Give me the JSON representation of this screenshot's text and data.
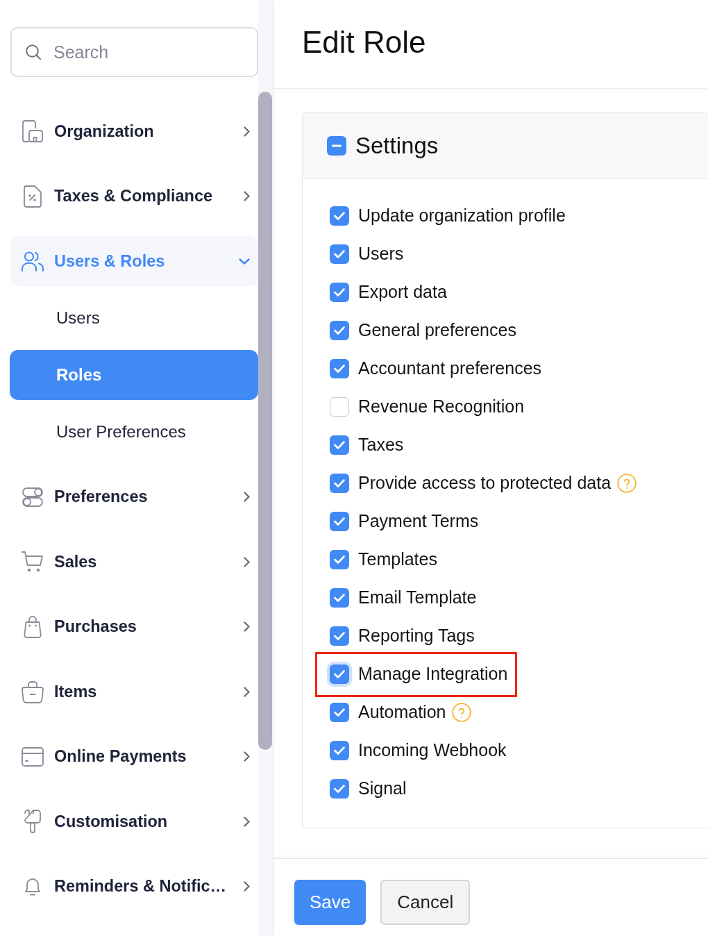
{
  "search": {
    "placeholder": "Search"
  },
  "nav": [
    {
      "label": "Organization",
      "selected": false,
      "expanded": false
    },
    {
      "label": "Taxes & Compliance",
      "selected": false,
      "expanded": false
    },
    {
      "label": "Users & Roles",
      "selected": true,
      "expanded": true,
      "children": [
        {
          "label": "Users",
          "selected": false
        },
        {
          "label": "Roles",
          "selected": true
        },
        {
          "label": "User Preferences",
          "selected": false
        }
      ]
    },
    {
      "label": "Preferences",
      "selected": false,
      "expanded": false
    },
    {
      "label": "Sales",
      "selected": false,
      "expanded": false
    },
    {
      "label": "Purchases",
      "selected": false,
      "expanded": false
    },
    {
      "label": "Items",
      "selected": false,
      "expanded": false
    },
    {
      "label": "Online Payments",
      "selected": false,
      "expanded": false
    },
    {
      "label": "Customisation",
      "selected": false,
      "expanded": false
    },
    {
      "label": "Reminders & Notific…",
      "selected": false,
      "expanded": false
    }
  ],
  "page": {
    "title": "Edit Role"
  },
  "settings": {
    "title": "Settings",
    "select_all_partial": true,
    "items": [
      {
        "label": "Update organization profile",
        "checked": true,
        "help": false,
        "focused": false,
        "highlighted": false
      },
      {
        "label": "Users",
        "checked": true,
        "help": false,
        "focused": false,
        "highlighted": false
      },
      {
        "label": "Export data",
        "checked": true,
        "help": false,
        "focused": false,
        "highlighted": false
      },
      {
        "label": "General preferences",
        "checked": true,
        "help": false,
        "focused": false,
        "highlighted": false
      },
      {
        "label": "Accountant preferences",
        "checked": true,
        "help": false,
        "focused": false,
        "highlighted": false
      },
      {
        "label": "Revenue Recognition",
        "checked": false,
        "help": false,
        "focused": false,
        "highlighted": false
      },
      {
        "label": "Taxes",
        "checked": true,
        "help": false,
        "focused": false,
        "highlighted": false
      },
      {
        "label": "Provide access to protected data",
        "checked": true,
        "help": true,
        "focused": false,
        "highlighted": false
      },
      {
        "label": "Payment Terms",
        "checked": true,
        "help": false,
        "focused": false,
        "highlighted": false
      },
      {
        "label": "Templates",
        "checked": true,
        "help": false,
        "focused": false,
        "highlighted": false
      },
      {
        "label": "Email Template",
        "checked": true,
        "help": false,
        "focused": false,
        "highlighted": false
      },
      {
        "label": "Reporting Tags",
        "checked": true,
        "help": false,
        "focused": false,
        "highlighted": false
      },
      {
        "label": "Manage Integration",
        "checked": true,
        "help": false,
        "focused": true,
        "highlighted": true
      },
      {
        "label": "Automation",
        "checked": true,
        "help": true,
        "focused": false,
        "highlighted": false
      },
      {
        "label": "Incoming Webhook",
        "checked": true,
        "help": false,
        "focused": false,
        "highlighted": false
      },
      {
        "label": "Signal",
        "checked": true,
        "help": false,
        "focused": false,
        "highlighted": false
      }
    ]
  },
  "buttons": [
    {
      "label": "Save",
      "kind": "primary"
    },
    {
      "label": "Cancel",
      "kind": "secondary"
    }
  ]
}
